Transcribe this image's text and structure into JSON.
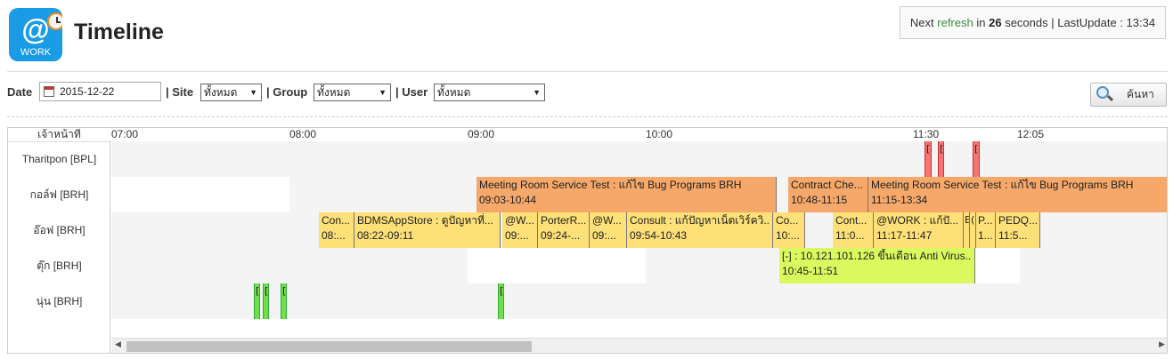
{
  "header": {
    "logo_text": "WORK",
    "logo_glyph": "@",
    "title": "Timeline",
    "refresh": {
      "prefix": "Next",
      "word": "refresh",
      "middle": "in",
      "seconds": "26",
      "suffix": "seconds | LastUpdate : 13:34"
    }
  },
  "filters": {
    "date_label": "Date",
    "date_value": "2015-12-22",
    "site_label": "| Site",
    "site_value": "ทั้งหมด",
    "group_label": "| Group",
    "group_value": "ทั้งหมด",
    "user_label": "| User",
    "user_value": "ทั้งหมด",
    "search_label": "ค้นหา"
  },
  "timeline": {
    "column_header": "เจ้าหน้าที่",
    "ticks": [
      "07:00",
      "08:00",
      "09:00",
      "10:00",
      "11:30",
      "12:05"
    ],
    "rows": [
      {
        "label": "Tharitpon [BPL]"
      },
      {
        "label": "กอล์ฟ [BRH]"
      },
      {
        "label": "อ๊อฟ [BRH]"
      },
      {
        "label": "ตุ๊ก [BRH]"
      },
      {
        "label": "นุ่น [BRH]"
      }
    ],
    "events": {
      "r1_e1": {
        "title": "Meeting Room Service Test : แก้ไข Bug Programs BRH",
        "time": "09:03-10:44"
      },
      "r1_e2": {
        "title": "Contract Che...",
        "time": "10:48-11:15"
      },
      "r1_e3": {
        "title": "Meeting Room Service Test : แก้ไข Bug Programs BRH",
        "time": "11:15-13:34"
      },
      "r2_e1": {
        "title": "Con...",
        "time": "08:..."
      },
      "r2_e2": {
        "title": "BDMSAppStore : ดูปัญหาที่...",
        "time": "08:22-09:11"
      },
      "r2_e3": {
        "title": "@W...",
        "time": "09:..."
      },
      "r2_e4": {
        "title": "PorterR...",
        "time": "09:24-..."
      },
      "r2_e5": {
        "title": "@W...",
        "time": "09:..."
      },
      "r2_e6": {
        "title": "Consult : แก้ปัญหาเน็ตเวิร์ควิ...",
        "time": "09:54-10:43"
      },
      "r2_e7": {
        "title": "Co...",
        "time": "10:..."
      },
      "r2_e8": {
        "title": "Cont...",
        "time": "11:0..."
      },
      "r2_e9": {
        "title": "@WORK : แก้ปั...",
        "time": "11:17-11:47"
      },
      "r2_e10": {
        "title": "P...",
        "time": "1..."
      },
      "r2_e11": {
        "title": "PEDQ...",
        "time": "11:5..."
      },
      "r3_e1": {
        "title": "[-] : 10.121.101.126 ขึ้นเตือน Anti Virus...",
        "time": "10:45-11:51"
      }
    }
  },
  "colors": {
    "orange": "#f5a86a",
    "yellow": "#fde077",
    "lime": "#dcf85f",
    "red": "#f67474",
    "green": "#6ede4a",
    "logo_blue": "#1a9be6"
  }
}
